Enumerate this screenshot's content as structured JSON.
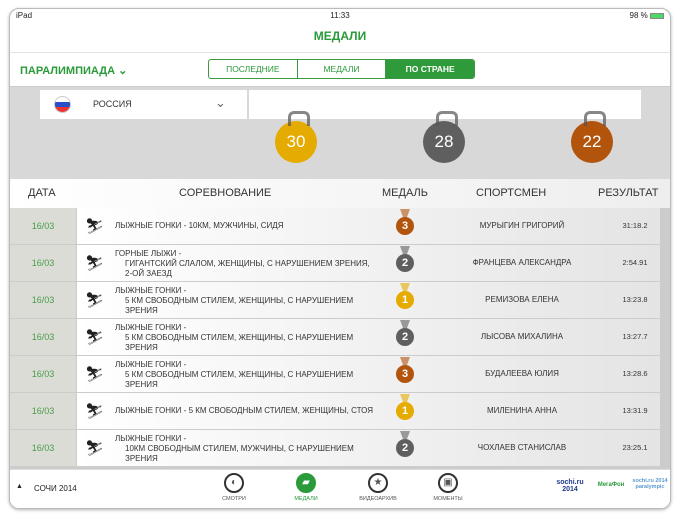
{
  "status": {
    "device": "iPad",
    "time": "11:33",
    "battery": "98 %"
  },
  "header": {
    "title": "МЕДАЛИ"
  },
  "nav": {
    "selector": "ПАРАЛИМПИАДА",
    "tabs": [
      {
        "label": "ПОСЛЕДНИЕ",
        "active": false
      },
      {
        "label": "МЕДАЛИ",
        "active": false
      },
      {
        "label": "ПО СТРАНЕ",
        "active": true
      }
    ]
  },
  "country": {
    "name": "РОССИЯ"
  },
  "medals": {
    "gold": "30",
    "silver": "28",
    "bronze": "22"
  },
  "colors": {
    "gold": "#e5ab00",
    "silver": "#5f5f5f",
    "bronze": "#b3540c",
    "accent": "#2f9a3a"
  },
  "table": {
    "headers": [
      "ДАТА",
      "СОРЕВНОВАНИЕ",
      "МЕДАЛЬ",
      "СПОРТСМЕН",
      "РЕЗУЛЬТАТ"
    ],
    "rows": [
      {
        "date": "16/03",
        "sport": "ЛЫЖНЫЕ ГОНКИ -",
        "event": "10КМ, МУЖЧИНЫ, СИДЯ",
        "medal": "3",
        "athlete": "МУРЫГИН ГРИГОРИЙ",
        "result": "31:18.2"
      },
      {
        "date": "16/03",
        "sport": "ГОРНЫЕ ЛЫЖИ -",
        "event": "ГИГАНТСКИЙ СЛАЛОМ, ЖЕНЩИНЫ, С НАРУШЕНИЕМ ЗРЕНИЯ, 2-ОЙ ЗАЕЗД",
        "medal": "2",
        "athlete": "ФРАНЦЕВА АЛЕКСАНДРА",
        "result": "2:54.91"
      },
      {
        "date": "16/03",
        "sport": "ЛЫЖНЫЕ ГОНКИ -",
        "event": "5 КМ СВОБОДНЫМ СТИЛЕМ, ЖЕНЩИНЫ, С НАРУШЕНИЕМ ЗРЕНИЯ",
        "medal": "1",
        "athlete": "РЕМИЗОВА ЕЛЕНА",
        "result": "13:23.8"
      },
      {
        "date": "16/03",
        "sport": "ЛЫЖНЫЕ ГОНКИ -",
        "event": "5 КМ СВОБОДНЫМ СТИЛЕМ, ЖЕНЩИНЫ, С НАРУШЕНИЕМ ЗРЕНИЯ",
        "medal": "2",
        "athlete": "ЛЫСОВА МИХАЛИНА",
        "result": "13:27.7"
      },
      {
        "date": "16/03",
        "sport": "ЛЫЖНЫЕ ГОНКИ -",
        "event": "5 КМ СВОБОДНЫМ СТИЛЕМ, ЖЕНЩИНЫ, С НАРУШЕНИЕМ ЗРЕНИЯ",
        "medal": "3",
        "athlete": "БУДАЛЕЕВА ЮЛИЯ",
        "result": "13:28.6"
      },
      {
        "date": "16/03",
        "sport": "ЛЫЖНЫЕ ГОНКИ -",
        "event": "5 КМ СВОБОДНЫМ СТИЛЕМ, ЖЕНЩИНЫ, СТОЯ",
        "medal": "1",
        "athlete": "МИЛЕНИНА АННА",
        "result": "13:31.9"
      },
      {
        "date": "16/03",
        "sport": "ЛЫЖНЫЕ ГОНКИ -",
        "event": "10КМ СВОБОДНЫМ СТИЛЕМ, МУЖЧИНЫ, С НАРУШЕНИЕМ ЗРЕНИЯ",
        "medal": "2",
        "athlete": "ЧОХЛАЕВ СТАНИСЛАВ",
        "result": "23:25.1"
      }
    ]
  },
  "bottom": {
    "label": "СОЧИ 2014",
    "tabs": [
      {
        "label": "СМОТРИ",
        "icon": "◐"
      },
      {
        "label": "МЕДАЛИ",
        "icon": "▰"
      },
      {
        "label": "ВИДЕОАРХИВ",
        "icon": "★"
      },
      {
        "label": "МОМЕНТЫ",
        "icon": "▣"
      }
    ],
    "logos": [
      "sochi.ru 2014",
      "МегаФон",
      "sochi.ru 2014 paralympic"
    ]
  }
}
